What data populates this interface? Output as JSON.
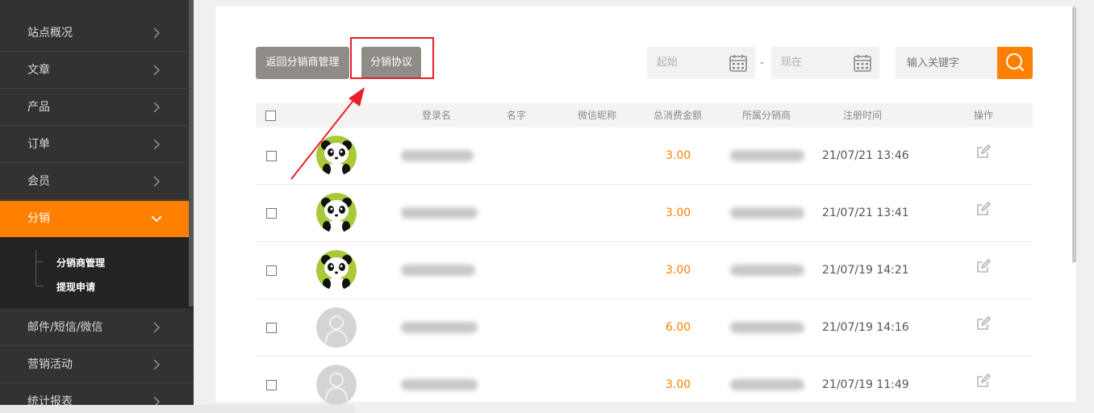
{
  "sidebar": {
    "items": [
      {
        "label": "站点概况"
      },
      {
        "label": "文章"
      },
      {
        "label": "产品"
      },
      {
        "label": "订单"
      },
      {
        "label": "会员"
      },
      {
        "label": "分销"
      },
      {
        "label": "邮件/短信/微信"
      },
      {
        "label": "营销活动"
      },
      {
        "label": "统计报表"
      }
    ],
    "active_index": 5,
    "submenu": [
      {
        "label": "分销商管理"
      },
      {
        "label": "提现申请"
      }
    ]
  },
  "toolbar": {
    "back_label": "返回分销商管理",
    "agreement_label": "分销协议",
    "start_placeholder": "起始",
    "end_placeholder": "现在",
    "separator": "-",
    "keyword_placeholder": "输入关键字"
  },
  "table": {
    "headers": {
      "login": "登录名",
      "name": "名字",
      "wechat": "微信昵称",
      "total": "总消费金额",
      "distributor": "所属分销商",
      "reg_time": "注册时间",
      "action": "操作"
    },
    "rows": [
      {
        "avatar": "panda",
        "amount": "3.00",
        "reg_time": "21/07/21 13:46"
      },
      {
        "avatar": "panda",
        "amount": "3.00",
        "reg_time": "21/07/21 13:41"
      },
      {
        "avatar": "panda",
        "amount": "3.00",
        "reg_time": "21/07/19 14:21"
      },
      {
        "avatar": "default",
        "amount": "6.00",
        "reg_time": "21/07/19 14:16"
      },
      {
        "avatar": "default",
        "amount": "3.00",
        "reg_time": "21/07/19 11:49"
      }
    ]
  },
  "colors": {
    "accent": "#ff7f00",
    "sidebar_bg": "#323232",
    "highlight": "#e8202a"
  }
}
